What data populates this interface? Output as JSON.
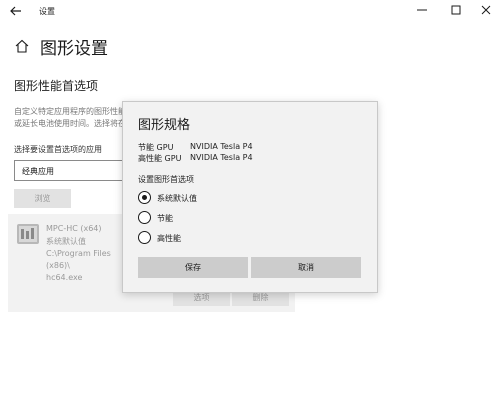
{
  "window": {
    "title": "设置",
    "controls": {
      "back": "back-arrow-icon",
      "minimize": "minimize-icon",
      "maximize": "maximize-icon",
      "close": "close-icon"
    }
  },
  "header": {
    "icon": "home-icon",
    "title": "图形设置"
  },
  "section": {
    "title": "图形性能首选项",
    "description_line1": "自定义特定应用程序的图形性能首选项。首选项可能会提供更好的应用程序性能",
    "description_line2": "或延长电池使用时间。选择将在下次启动应用时生效。",
    "choose_label": "选择要设置首选项的应用",
    "app_type_value": "经典应用",
    "browse_label": "浏览"
  },
  "app_entry": {
    "icon": "mpc-hc-icon",
    "name": "MPC-HC (x64)",
    "preference": "系统默认值",
    "path_line1": "C:\\Program Files (x86)\\",
    "path_line2": "hc64.exe",
    "options_label": "选项",
    "delete_label": "删除"
  },
  "dialog": {
    "title": "图形规格",
    "specs": [
      {
        "label": "节能 GPU",
        "value": "NVIDIA Tesla P4"
      },
      {
        "label": "高性能 GPU",
        "value": "NVIDIA Tesla P4"
      }
    ],
    "preference_heading": "设置图形首选项",
    "options": [
      {
        "label": "系统默认值",
        "checked": true
      },
      {
        "label": "节能",
        "checked": false
      },
      {
        "label": "高性能",
        "checked": false
      }
    ],
    "save_label": "保存",
    "cancel_label": "取消"
  }
}
